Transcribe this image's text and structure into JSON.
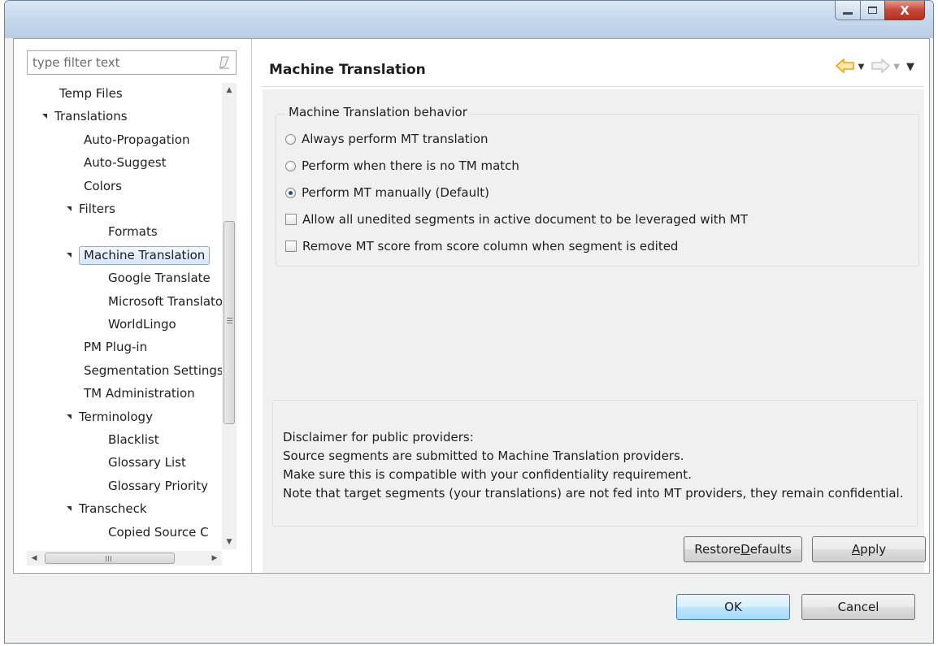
{
  "window": {
    "close_glyph": "X"
  },
  "filter": {
    "placeholder": "type filter text"
  },
  "tree": {
    "items": [
      {
        "label": "Temp Files",
        "level": 0,
        "expandable": false
      },
      {
        "label": "Translations",
        "level": 0,
        "expandable": true
      },
      {
        "label": "Auto-Propagation",
        "level": 1,
        "expandable": false
      },
      {
        "label": "Auto-Suggest",
        "level": 1,
        "expandable": false
      },
      {
        "label": "Colors",
        "level": 1,
        "expandable": false
      },
      {
        "label": "Filters",
        "level": 1,
        "expandable": true
      },
      {
        "label": "Formats",
        "level": 2,
        "expandable": false
      },
      {
        "label": "Machine Translation",
        "level": 1,
        "expandable": true,
        "selected": true
      },
      {
        "label": "Google Translate",
        "level": 2,
        "expandable": false
      },
      {
        "label": "Microsoft Translator",
        "level": 2,
        "expandable": false
      },
      {
        "label": "WorldLingo",
        "level": 2,
        "expandable": false
      },
      {
        "label": "PM Plug-in",
        "level": 1,
        "expandable": false
      },
      {
        "label": "Segmentation Settings",
        "level": 1,
        "expandable": false
      },
      {
        "label": "TM Administration",
        "level": 1,
        "expandable": false
      },
      {
        "label": "Terminology",
        "level": 1,
        "expandable": true
      },
      {
        "label": "Blacklist",
        "level": 2,
        "expandable": false
      },
      {
        "label": "Glossary List",
        "level": 2,
        "expandable": false
      },
      {
        "label": "Glossary Priority",
        "level": 2,
        "expandable": false
      },
      {
        "label": "Transcheck",
        "level": 1,
        "expandable": true
      },
      {
        "label": "Copied Source C",
        "level": 2,
        "expandable": false
      }
    ]
  },
  "page": {
    "title": "Machine Translation",
    "group_label": "Machine Translation behavior",
    "options": [
      {
        "type": "radio",
        "label": "Always perform MT translation",
        "checked": false
      },
      {
        "type": "radio",
        "label": "Perform when there is no TM match",
        "checked": false
      },
      {
        "type": "radio",
        "label": "Perform MT manually (Default)",
        "checked": true
      },
      {
        "type": "checkbox",
        "label": "Allow all unedited segments in active document to be leveraged with MT",
        "checked": false
      },
      {
        "type": "checkbox",
        "label": "Remove MT score from score column when segment is edited",
        "checked": false
      }
    ],
    "disclaimer": [
      "Disclaimer for public providers:",
      "Source segments are submitted to Machine Translation providers.",
      "Make sure this is compatible with your confidentiality requirement.",
      "Note that target segments (your translations) are not fed into MT providers, they remain confidential."
    ],
    "restore_defaults": {
      "before": "Restore ",
      "mnemonic": "D",
      "after": "efaults"
    },
    "apply": {
      "before": "",
      "mnemonic": "A",
      "after": "pply"
    }
  },
  "footer": {
    "ok_label": "OK",
    "cancel_label": "Cancel"
  },
  "colors": {
    "back_arrow": "#e9a21b",
    "forward_arrow": "#c8c8c8",
    "selection_border": "#84acdd"
  }
}
